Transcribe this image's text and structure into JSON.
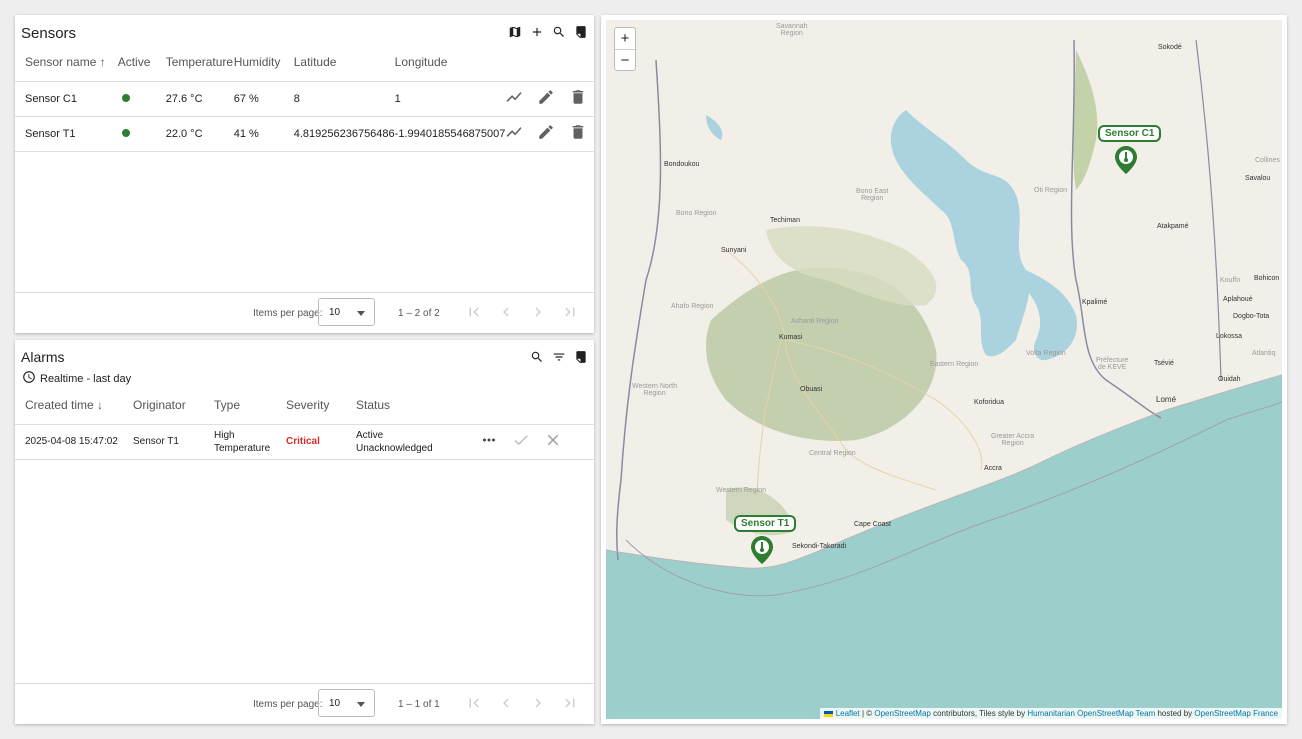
{
  "sensors_panel": {
    "title": "Sensors",
    "columns": [
      "Sensor name",
      "Active",
      "Temperature",
      "Humidity",
      "Latitude",
      "Longitude"
    ],
    "sort_indicator": "↑",
    "rows": [
      {
        "name": "Sensor C1",
        "active": true,
        "temperature": "27.6 °C",
        "humidity": "67 %",
        "latitude": "8",
        "longitude": "1"
      },
      {
        "name": "Sensor T1",
        "active": true,
        "temperature": "22.0 °C",
        "humidity": "41 %",
        "latitude": "4.819256236756486",
        "longitude": "-1.9940185546875007"
      }
    ],
    "paginator": {
      "items_per_page_label": "Items per page:",
      "page_size": "10",
      "range": "1 – 2 of 2"
    }
  },
  "alarms_panel": {
    "title": "Alarms",
    "time_window": "Realtime - last day",
    "columns": [
      "Created time",
      "Originator",
      "Type",
      "Severity",
      "Status"
    ],
    "sort_indicator": "↓",
    "rows": [
      {
        "created": "2025-04-08 15:47:02",
        "originator": "Sensor T1",
        "type_line1": "High",
        "type_line2": "Temperature",
        "severity": "Critical",
        "status_line1": "Active",
        "status_line2": "Unacknowledged"
      }
    ],
    "paginator": {
      "items_per_page_label": "Items per page:",
      "page_size": "10",
      "range": "1 – 1 of 1"
    }
  },
  "map": {
    "zoom_in": "+",
    "zoom_out": "−",
    "markers": [
      {
        "label": "Sensor C1"
      },
      {
        "label": "Sensor T1"
      }
    ],
    "attribution": {
      "leaflet": "Leaflet",
      "sep": " | © ",
      "osm": "OpenStreetMap",
      "contrib": " contributors, Tiles style by ",
      "hot": "Humanitarian OpenStreetMap Team",
      "hosted": " hosted by ",
      "osmfr": "OpenStreetMap France"
    },
    "labels": {
      "savannah": "Savannah\nRegion",
      "sokode": "Sokodé",
      "bondoukou": "Bondoukou",
      "bono_east": "Bono East\nRegion",
      "bono": "Bono Region",
      "techiman": "Techiman",
      "sunyani": "Sunyani",
      "ahafo": "Ahafo Region",
      "ashanti": "Ashanti Region",
      "kumasi": "Kumasi",
      "obuasi": "Obuasi",
      "western_north": "Western North\nRegion",
      "eastern": "Eastern Region",
      "koforidua": "Koforidua",
      "greater_accra": "Greater Accra\nRegion",
      "accra": "Accra",
      "central": "Central Region",
      "western": "Western Region",
      "cape_coast": "Cape Coast",
      "sekondi": "Sekondi-Takoradi",
      "volta": "Volta Region",
      "oti": "Oti Region",
      "kpalime": "Kpalimé",
      "atakpame": "Atakpamé",
      "kouffo": "Kouffo",
      "aplahoue": "Aplahoué",
      "dogbo": "Dogbo-Tota",
      "lokossa": "Lokossa",
      "bohicon": "Bohicon",
      "savalou": "Savalou",
      "collines": "Collines",
      "tsevie": "Tsévié",
      "kloto": "Préfecture\nde KEVE",
      "lome": "Lomé",
      "ouidah": "Ouidah",
      "atlantique": "Atlantiq"
    }
  }
}
